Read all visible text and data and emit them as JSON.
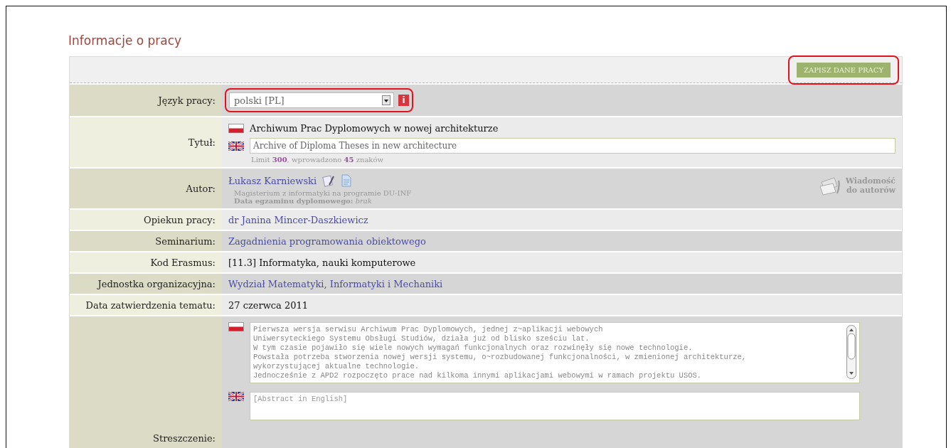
{
  "heading": "Informacje o pracy",
  "save_button": "ZAPISZ DANE PRACY",
  "rows": [
    {
      "kind": "language",
      "label": "Język pracy:",
      "value": "polski [PL]",
      "info": "i"
    },
    {
      "kind": "title",
      "label": "Tytuł:",
      "title_pl": "Archiwum Prac Dyplomowych w nowej architekturze",
      "title_en": "Archive of Diploma Theses in new architecture",
      "limit": "Limit **300**, wprowadzono **45** znaków"
    },
    {
      "kind": "author",
      "label": "Autor:",
      "name": "Łukasz Karniewski",
      "program": "Magisterium z informatyki na programie DU-INF",
      "exam": "**Data egzaminu dyplomowego:** *brak*",
      "message": "Wiadomość do autorów"
    },
    {
      "kind": "link",
      "label": "Opiekun pracy:",
      "value": "dr Janina Mincer-Daszkiewicz"
    },
    {
      "kind": "link",
      "label": "Seminarium:",
      "value": "Zagadnienia programowania obiektowego"
    },
    {
      "kind": "text",
      "label": "Kod Erasmus:",
      "value": "[11.3] Informatyka, nauki komputerowe"
    },
    {
      "kind": "link",
      "label": "Jednostka organizacyjna:",
      "value": "Wydział Matematyki, Informatyki i Mechaniki"
    },
    {
      "kind": "text",
      "label": "Data zatwierdzenia tematu:",
      "value": "27 czerwca 2011"
    },
    {
      "kind": "abstract",
      "label": "Streszczenie:",
      "lines_pl": [
        "Pierwsza wersja serwisu Archiwum Prac Dyplomowych, jednej z~aplikacji webowych",
        "Uniwersyteckiego Systemu Obsługi Studiów, działa już od blisko sześciu lat.",
        "W tym czasie pojawiło się wiele nowych wymagań funkcjonalnych oraz rozwinęły się nowe technologie.",
        "Powstała potrzeba stworzenia nowej wersji systemu, o~rozbudowanej funkcjonalności, w zmienionej architekturze,",
        "wykorzystującej aktualne technologie.",
        "Jednocześnie z APD2 rozpoczęto prace nad kilkoma innymi aplikacjami webowymi w ramach projektu USOS."
      ],
      "placeholder_en": "[Abstract in English]"
    }
  ]
}
